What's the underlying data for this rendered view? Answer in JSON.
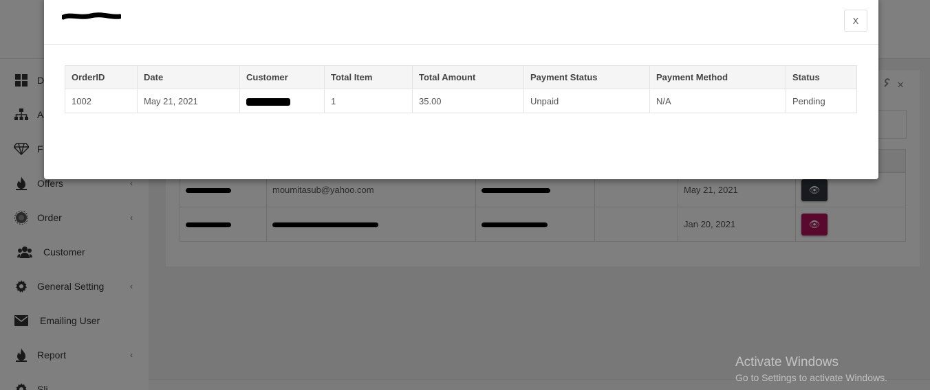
{
  "sidebar": {
    "items": [
      {
        "label": "D",
        "icon": "dashboard-icon",
        "chevron": false
      },
      {
        "label": "A",
        "icon": "sitemap-icon",
        "chevron": false
      },
      {
        "label": "F",
        "icon": "diamond-icon",
        "chevron": false
      },
      {
        "label": "Offers",
        "icon": "fire-icon",
        "chevron": true
      },
      {
        "label": "Order",
        "icon": "gear-alt-icon",
        "chevron": true
      },
      {
        "label": "Customer",
        "icon": "users-icon",
        "chevron": false
      },
      {
        "label": "General Setting",
        "icon": "gear-icon",
        "chevron": true
      },
      {
        "label": "Emailing User",
        "icon": "envelope-icon",
        "chevron": false
      },
      {
        "label": "Report",
        "icon": "fire-icon",
        "chevron": true
      },
      {
        "label": "Sli",
        "icon": "gear-icon",
        "chevron": false
      }
    ],
    "chevron_glyph": "‹"
  },
  "background_table": {
    "rows": [
      {
        "email": "moumitasub@yahoo.com",
        "date": "May 21, 2021",
        "button_color": "#2f3640"
      },
      {
        "email": "",
        "date": "Jan 20, 2021",
        "button_color": "#b0125b"
      }
    ]
  },
  "modal": {
    "close_label": "X",
    "table": {
      "headers": [
        "OrderID",
        "Date",
        "Customer",
        "Total Item",
        "Total Amount",
        "Payment Status",
        "Payment Method",
        "Status"
      ],
      "rows": [
        {
          "order_id": "1002",
          "date": "May 21, 2021",
          "customer": "",
          "total_item": "1",
          "total_amount": "35.00",
          "payment_status": "Unpaid",
          "payment_method": "N/A",
          "status": "Pending"
        }
      ]
    }
  },
  "watermark": {
    "line1": "Activate Windows",
    "line2": "Go to Settings to activate Windows."
  }
}
